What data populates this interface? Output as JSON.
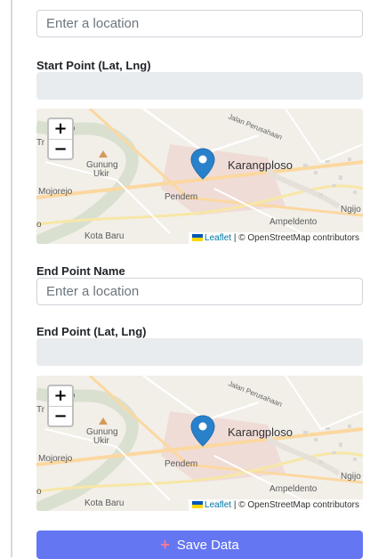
{
  "form": {
    "start_name_placeholder": "Enter a location",
    "start_point_label": "Start Point (Lat, Lng)",
    "start_point_value": "",
    "end_name_label": "End Point Name",
    "end_name_placeholder": "Enter a location",
    "end_point_label": "End Point (Lat, Lng)",
    "end_point_value": ""
  },
  "map": {
    "zoom_in": "+",
    "zoom_out": "−",
    "places": {
      "t_rejo": "Tr",
      "rejo": "ejo",
      "gunung": "Gunung",
      "ukir": "Ukir",
      "karangploso": "Karangploso",
      "mojorejo": "Mojorejo",
      "pendem": "Pendem",
      "ngijo": "Ngijo",
      "ampeldento": "Ampeldento",
      "kota_baru": "Kota Baru",
      "o": "o",
      "road": "Jalan Perusahaan"
    },
    "attribution_leaflet": "Leaflet",
    "attribution_rest": " | © OpenStreetMap contributors",
    "marker_color": "#2a81cb"
  },
  "actions": {
    "save_label": "Save Data",
    "save_color": "#6576f2"
  }
}
